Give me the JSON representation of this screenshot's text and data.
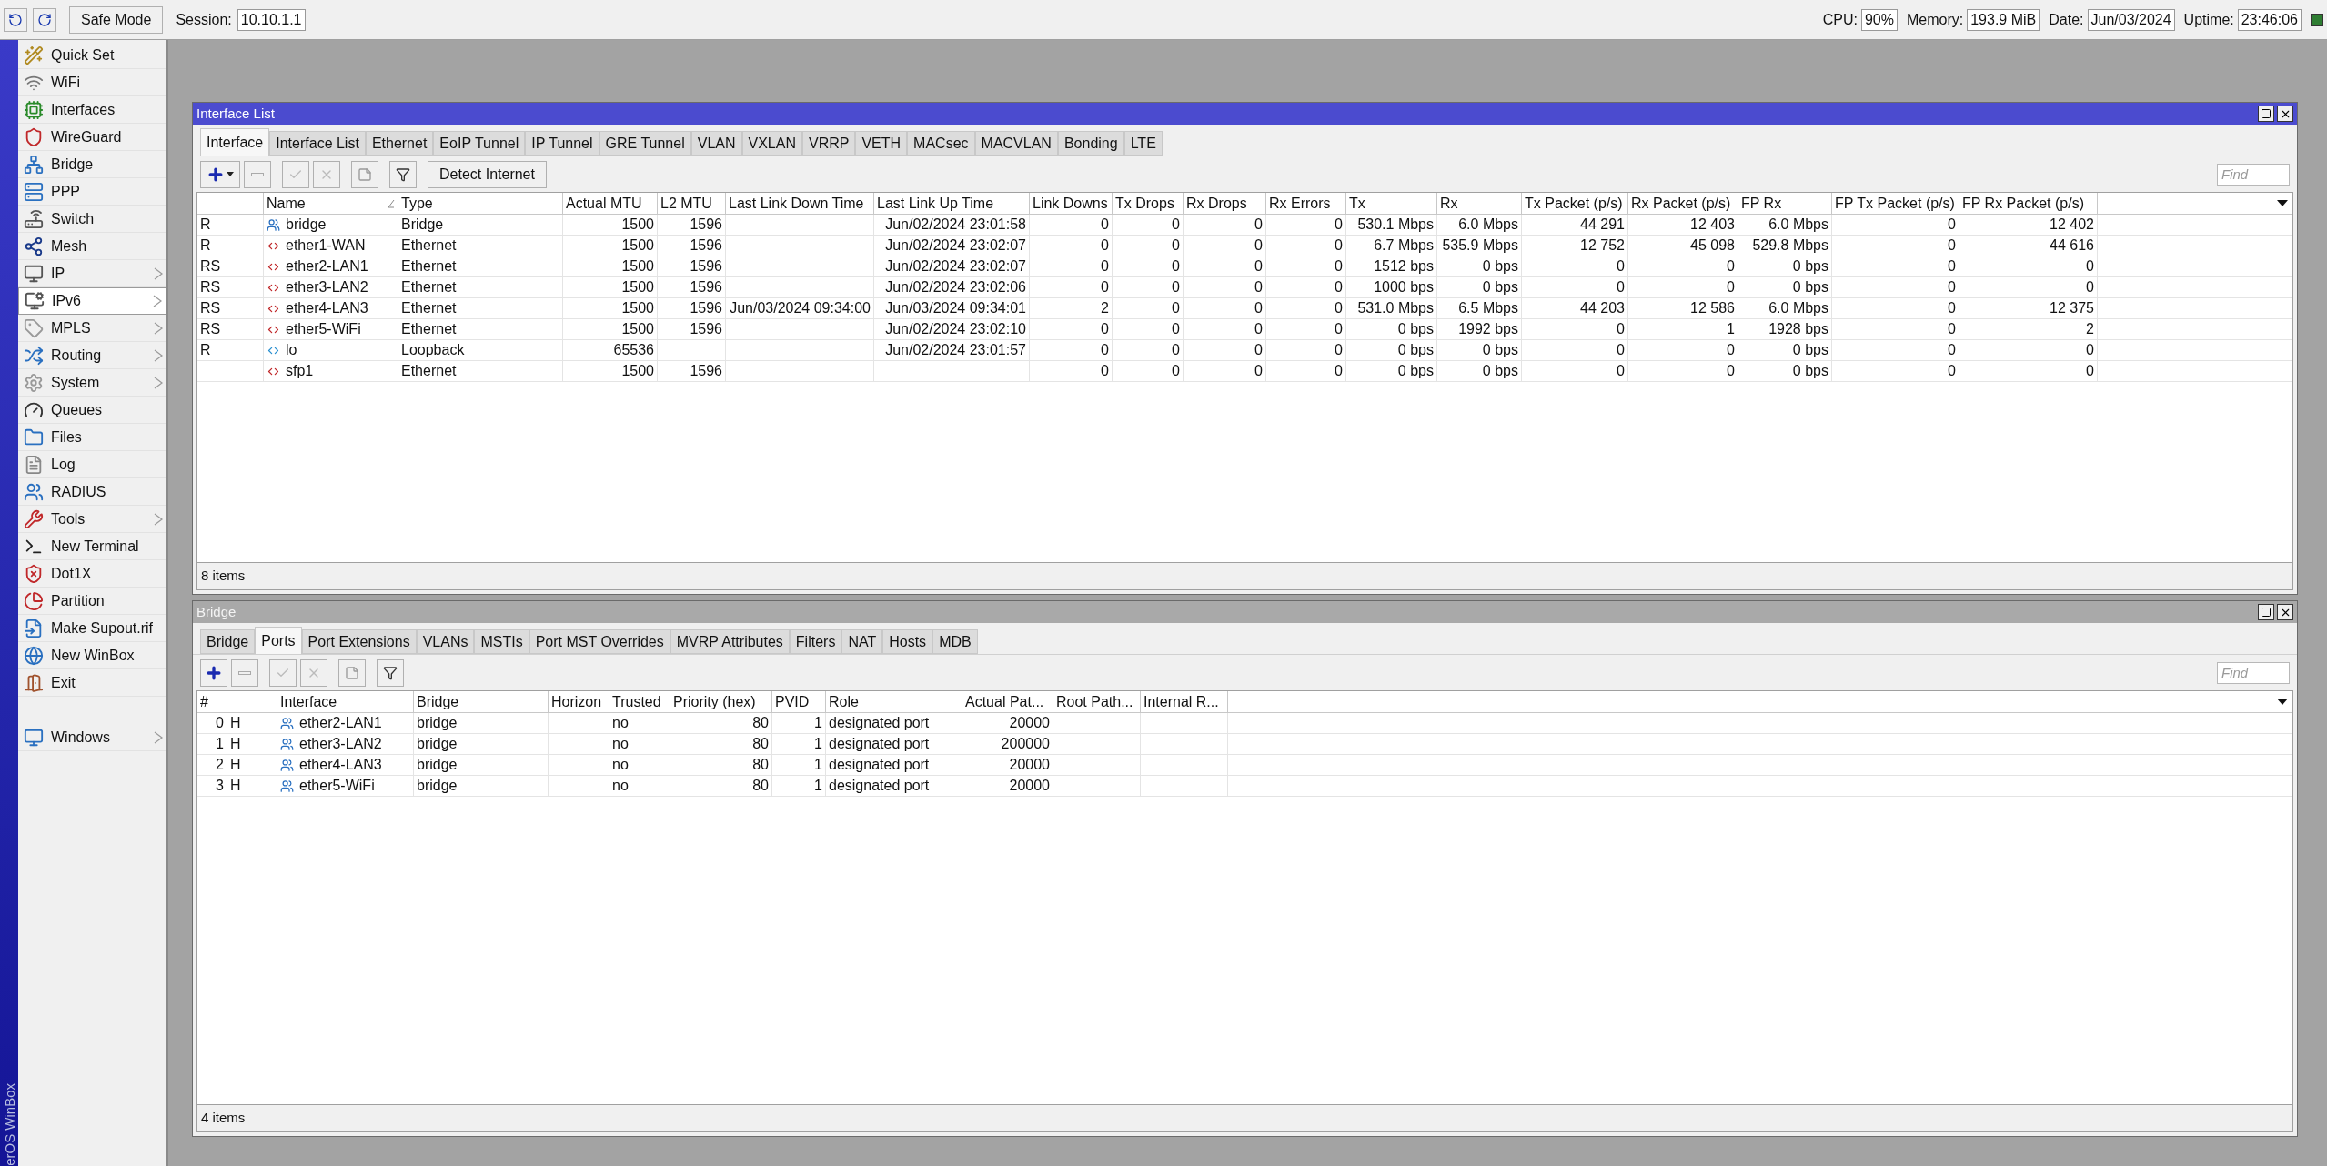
{
  "top_bar": {
    "safe_mode": "Safe Mode",
    "session_label": "Session:",
    "session_value": "10.10.1.1",
    "stats": [
      {
        "label": "CPU:",
        "value": "90%"
      },
      {
        "label": "Memory:",
        "value": "193.9 MiB"
      },
      {
        "label": "Date:",
        "value": "Jun/03/2024"
      },
      {
        "label": "Uptime:",
        "value": "23:46:06"
      }
    ]
  },
  "brand": "erOS WinBox",
  "sidebar": {
    "items": [
      {
        "label": "Quick Set",
        "submenu": false,
        "selected": false
      },
      {
        "label": "WiFi",
        "submenu": false,
        "selected": false
      },
      {
        "label": "Interfaces",
        "submenu": false,
        "selected": false
      },
      {
        "label": "WireGuard",
        "submenu": false,
        "selected": false
      },
      {
        "label": "Bridge",
        "submenu": false,
        "selected": false
      },
      {
        "label": "PPP",
        "submenu": false,
        "selected": false
      },
      {
        "label": "Switch",
        "submenu": false,
        "selected": false
      },
      {
        "label": "Mesh",
        "submenu": false,
        "selected": false
      },
      {
        "label": "IP",
        "submenu": true,
        "selected": false
      },
      {
        "label": "IPv6",
        "submenu": true,
        "selected": true
      },
      {
        "label": "MPLS",
        "submenu": true,
        "selected": false
      },
      {
        "label": "Routing",
        "submenu": true,
        "selected": false
      },
      {
        "label": "System",
        "submenu": true,
        "selected": false
      },
      {
        "label": "Queues",
        "submenu": false,
        "selected": false
      },
      {
        "label": "Files",
        "submenu": false,
        "selected": false
      },
      {
        "label": "Log",
        "submenu": false,
        "selected": false
      },
      {
        "label": "RADIUS",
        "submenu": false,
        "selected": false
      },
      {
        "label": "Tools",
        "submenu": true,
        "selected": false
      },
      {
        "label": "New Terminal",
        "submenu": false,
        "selected": false
      },
      {
        "label": "Dot1X",
        "submenu": false,
        "selected": false
      },
      {
        "label": "Partition",
        "submenu": false,
        "selected": false
      },
      {
        "label": "Make Supout.rif",
        "submenu": false,
        "selected": false
      },
      {
        "label": "New WinBox",
        "submenu": false,
        "selected": false
      },
      {
        "label": "Exit",
        "submenu": false,
        "selected": false
      }
    ],
    "footer_items": [
      {
        "label": "Windows",
        "submenu": true,
        "selected": false
      }
    ]
  },
  "windows": [
    {
      "title": "Interface List",
      "active": true,
      "add_menu": true,
      "extra_button": "Detect Internet",
      "find_placeholder": "Find",
      "footer": "8 items",
      "tabs": [
        {
          "label": "Interface",
          "selected": true
        },
        {
          "label": "Interface List",
          "selected": false
        },
        {
          "label": "Ethernet",
          "selected": false
        },
        {
          "label": "EoIP Tunnel",
          "selected": false
        },
        {
          "label": "IP Tunnel",
          "selected": false
        },
        {
          "label": "GRE Tunnel",
          "selected": false
        },
        {
          "label": "VLAN",
          "selected": false
        },
        {
          "label": "VXLAN",
          "selected": false
        },
        {
          "label": "VRRP",
          "selected": false
        },
        {
          "label": "VETH",
          "selected": false
        },
        {
          "label": "MACsec",
          "selected": false
        },
        {
          "label": "MACVLAN",
          "selected": false
        },
        {
          "label": "Bonding",
          "selected": false
        },
        {
          "label": "LTE",
          "selected": false
        }
      ],
      "columns": [
        {},
        {
          "label": "Name",
          "sorted": true
        },
        {
          "label": "Type"
        },
        {
          "label": "Actual MTU"
        },
        {
          "label": "L2 MTU"
        },
        {
          "label": "Last Link Down Time"
        },
        {
          "label": "Last Link Up Time"
        },
        {
          "label": "Link Downs"
        },
        {
          "label": "Tx Drops"
        },
        {
          "label": "Rx Drops"
        },
        {
          "label": "Rx Errors"
        },
        {
          "label": "Tx"
        },
        {
          "label": "Rx"
        },
        {
          "label": "Tx Packet (p/s)"
        },
        {
          "label": "Rx Packet (p/s)"
        },
        {
          "label": "FP Rx"
        },
        {
          "label": "FP Tx Packet (p/s)"
        },
        {
          "label": "FP Rx Packet (p/s)"
        }
      ],
      "rows": [
        {
          "kind": "bridge",
          "cells": [
            "R",
            "bridge",
            "Bridge",
            "1500",
            "1596",
            null,
            "Jun/02/2024 23:01:58",
            "0",
            "0",
            "0",
            "0",
            "530.1 Mbps",
            "6.0 Mbps",
            "44 291",
            "12 403",
            "6.0 Mbps",
            "0",
            "12 402"
          ]
        },
        {
          "kind": "ethernet",
          "cells": [
            "R",
            "ether1-WAN",
            "Ethernet",
            "1500",
            "1596",
            null,
            "Jun/02/2024 23:02:07",
            "0",
            "0",
            "0",
            "0",
            "6.7 Mbps",
            "535.9 Mbps",
            "12 752",
            "45 098",
            "529.8 Mbps",
            "0",
            "44 616"
          ]
        },
        {
          "kind": "ethernet",
          "cells": [
            "RS",
            "ether2-LAN1",
            "Ethernet",
            "1500",
            "1596",
            null,
            "Jun/02/2024 23:02:07",
            "0",
            "0",
            "0",
            "0",
            "1512 bps",
            "0 bps",
            "0",
            "0",
            "0 bps",
            "0",
            "0"
          ]
        },
        {
          "kind": "ethernet",
          "cells": [
            "RS",
            "ether3-LAN2",
            "Ethernet",
            "1500",
            "1596",
            null,
            "Jun/02/2024 23:02:06",
            "0",
            "0",
            "0",
            "0",
            "1000 bps",
            "0 bps",
            "0",
            "0",
            "0 bps",
            "0",
            "0"
          ]
        },
        {
          "kind": "ethernet",
          "cells": [
            "RS",
            "ether4-LAN3",
            "Ethernet",
            "1500",
            "1596",
            "Jun/03/2024 09:34:00",
            "Jun/03/2024 09:34:01",
            "2",
            "0",
            "0",
            "0",
            "531.0 Mbps",
            "6.5 Mbps",
            "44 203",
            "12 586",
            "6.0 Mbps",
            "0",
            "12 375"
          ]
        },
        {
          "kind": "ethernet",
          "cells": [
            "RS",
            "ether5-WiFi",
            "Ethernet",
            "1500",
            "1596",
            null,
            "Jun/02/2024 23:02:10",
            "0",
            "0",
            "0",
            "0",
            "0 bps",
            "1992 bps",
            "0",
            "1",
            "1928 bps",
            "0",
            "2"
          ]
        },
        {
          "kind": "loopback",
          "cells": [
            "R",
            "lo",
            "Loopback",
            "65536",
            null,
            null,
            "Jun/02/2024 23:01:57",
            "0",
            "0",
            "0",
            "0",
            "0 bps",
            "0 bps",
            "0",
            "0",
            "0 bps",
            "0",
            "0"
          ]
        },
        {
          "kind": "ethernet",
          "cells": [
            null,
            "sfp1",
            "Ethernet",
            "1500",
            "1596",
            null,
            null,
            "0",
            "0",
            "0",
            "0",
            "0 bps",
            "0 bps",
            "0",
            "0",
            "0 bps",
            "0",
            "0"
          ]
        }
      ]
    },
    {
      "title": "Bridge",
      "active": false,
      "add_menu": false,
      "find_placeholder": "Find",
      "footer": "4 items",
      "tabs": [
        {
          "label": "Bridge",
          "selected": false
        },
        {
          "label": "Ports",
          "selected": true
        },
        {
          "label": "Port Extensions",
          "selected": false
        },
        {
          "label": "VLANs",
          "selected": false
        },
        {
          "label": "MSTIs",
          "selected": false
        },
        {
          "label": "Port MST Overrides",
          "selected": false
        },
        {
          "label": "MVRP Attributes",
          "selected": false
        },
        {
          "label": "Filters",
          "selected": false
        },
        {
          "label": "NAT",
          "selected": false
        },
        {
          "label": "Hosts",
          "selected": false
        },
        {
          "label": "MDB",
          "selected": false
        }
      ],
      "columns": [
        {
          "label": "#"
        },
        {},
        {
          "label": "Interface"
        },
        {
          "label": "Bridge"
        },
        {
          "label": "Horizon"
        },
        {
          "label": "Trusted"
        },
        {
          "label": "Priority (hex)"
        },
        {
          "label": "PVID"
        },
        {
          "label": "Role"
        },
        {
          "label": "Actual Pat..."
        },
        {
          "label": "Root Path..."
        },
        {
          "label": "Internal R..."
        }
      ],
      "rows": [
        {
          "kind": "bridge",
          "cells": [
            "0",
            "H",
            "ether2-LAN1",
            "bridge",
            null,
            "no",
            "80",
            "1",
            "designated port",
            "20000",
            null,
            null
          ]
        },
        {
          "kind": "bridge",
          "cells": [
            "1",
            "H",
            "ether3-LAN2",
            "bridge",
            null,
            "no",
            "80",
            "1",
            "designated port",
            "200000",
            null,
            null
          ]
        },
        {
          "kind": "bridge",
          "cells": [
            "2",
            "H",
            "ether4-LAN3",
            "bridge",
            null,
            "no",
            "80",
            "1",
            "designated port",
            "20000",
            null,
            null
          ]
        },
        {
          "kind": "bridge",
          "cells": [
            "3",
            "H",
            "ether5-WiFi",
            "bridge",
            null,
            "no",
            "80",
            "1",
            "designated port",
            "20000",
            null,
            null
          ]
        }
      ]
    }
  ]
}
